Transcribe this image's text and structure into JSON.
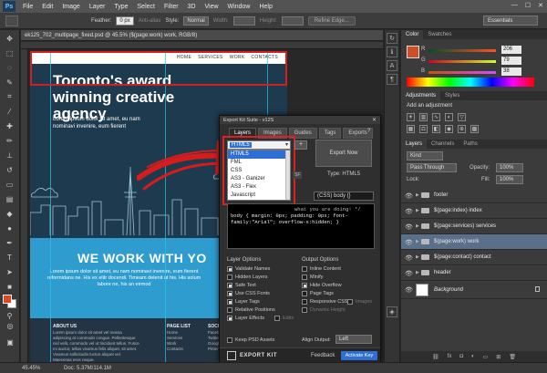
{
  "app": {
    "logo": "Ps",
    "menus": [
      "File",
      "Edit",
      "Image",
      "Layer",
      "Type",
      "Select",
      "Filter",
      "3D",
      "View",
      "Window",
      "Help"
    ],
    "window_controls": [
      "—",
      "☐",
      "✕"
    ]
  },
  "options_bar": {
    "feather_label": "Feather:",
    "feather_value": "0 px",
    "anti_alias_label": "Anti-alias",
    "style_label": "Style:",
    "style_value": "Normal",
    "width_label": "Width:",
    "height_label": "Height:",
    "refine_edge_label": "Refine Edge...",
    "workspace": "Essentials"
  },
  "document": {
    "tab_title": "ek125_702_multipage_fixed.psd @ 45.5% ($(page:work) work, RGB/8)",
    "zoom": "45.45%",
    "doc_size": "Doc: 5.37M/114.1M",
    "nav_items": [
      "HOME",
      "SERVICES",
      "WORK",
      "CONTACTS"
    ],
    "hero_title": "Toronto's award winning creative agency",
    "hero_text": "Lorem ipsum dolor sit amet, eu nam nominavi invenire, eum fierent",
    "work_title": "WE WORK WITH YO",
    "work_text": "Lorem ipsum dolor sit amet, eu nam nominavi invenire, eum fierent reformidans ne. His ex elitr docendi. Timeam delenit ut his. His solum labore ne, his an eirmod"
  },
  "footer_columns": [
    {
      "heading": "ABOUT US",
      "text": "Lorem ipsum dolor sit amet vel massa adipiscing at commodo congue. Pellentesque nisl velit, commodo vel ut tincidunt tellus. Fusce mi auctor, tellus vivamus felis aliquet, sit amet. Vivamus sollicitudin luctus aliquet vel. Maecenas eros neque."
    },
    {
      "heading": "PAGE LIST",
      "text": "Home\nServices\nWork\nContacts"
    },
    {
      "heading": "SOCIAL",
      "text": "Facebook\nTwitter\nGoogle+\nPinterest"
    }
  ],
  "export_kit": {
    "title": "Export Kit Suite - v12S",
    "close": "✕",
    "tabs": [
      "Layers",
      "Images",
      "Guides",
      "Tags",
      "Exports"
    ],
    "active_tab": "Layers",
    "help": "?",
    "format_selected": "HTML5",
    "format_options": [
      "HTML5",
      "FML",
      "CSS",
      "AS3 - Ganizer",
      "AS3 - Flex",
      "Javascript"
    ],
    "plus": "+",
    "export_now": "Export Now",
    "type_label": "Type:",
    "type_value": "HTML5",
    "sf_label": "SF",
    "css_select": "(CSS) body {}",
    "code_comment": "what you are doing! */",
    "code_text": "body { margin: 0px; padding: 0px; font-family:\"Arial\"; overflow-x:hidden; }",
    "layer_options_head": "Layer Options",
    "output_options_head": "Output Options",
    "layer_options": [
      {
        "label": "Validate Names",
        "checked": true
      },
      {
        "label": "Hidden Layers",
        "checked": false
      },
      {
        "label": "Safe Text",
        "checked": true
      },
      {
        "label": "Use CSS Fonts",
        "checked": true
      },
      {
        "label": "Layer Tags",
        "checked": true
      },
      {
        "label": "Relative Positions",
        "checked": false
      },
      {
        "label": "Layer Effects",
        "checked": true
      }
    ],
    "output_options": [
      {
        "label": "Inline Content",
        "checked": false
      },
      {
        "label": "Minify",
        "checked": false
      },
      {
        "label": "Hide Overflow",
        "checked": true
      },
      {
        "label": "Page Tags",
        "checked": false
      },
      {
        "label": "Responsive CSS",
        "checked": false
      },
      {
        "label": "Dynamic Height",
        "checked": false,
        "disabled": true
      }
    ],
    "extra_small": "Images",
    "layer_effects_small": "Edits",
    "keep_psd": "Keep PSD Assets",
    "align_output_label": "Align Output:",
    "align_output_value": "Left",
    "logo_text": "EXPORT KIT",
    "feedback": "Feedback",
    "activate": "Activate Key"
  },
  "color_panel": {
    "tabs": [
      "Color",
      "Swatches"
    ],
    "r": "206",
    "g": "79",
    "b": "38",
    "swatch_color": "#ce4f26"
  },
  "adjustments_panel": {
    "tabs": [
      "Adjustments",
      "Styles"
    ],
    "add_label": "Add an adjustment"
  },
  "layers_panel": {
    "tabs": [
      "Layers",
      "Channels",
      "Paths"
    ],
    "kind": "Kind",
    "blend_mode": "Pass Through",
    "opacity_label": "Opacity:",
    "opacity_value": "100%",
    "lock_label": "Lock:",
    "fill_label": "Fill:",
    "fill_value": "100%",
    "layers": [
      {
        "name": "footer",
        "selected": false
      },
      {
        "name": "$(page:index) index",
        "selected": false
      },
      {
        "name": "$(page:services) services",
        "selected": false
      },
      {
        "name": "$(page:work) work",
        "selected": true
      },
      {
        "name": "$(page:contact) contact",
        "selected": false
      },
      {
        "name": "header",
        "selected": false
      }
    ],
    "background_layer": "Background"
  }
}
